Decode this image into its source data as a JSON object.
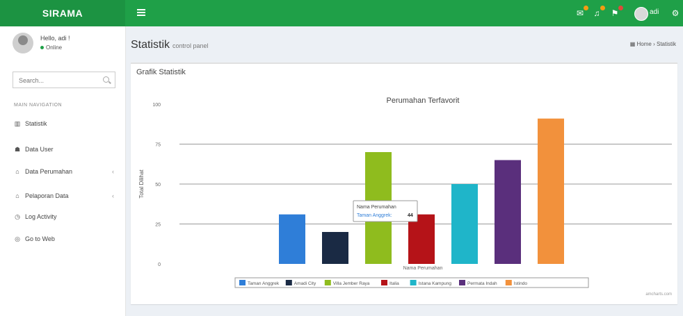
{
  "app": {
    "brand": "SIRAMA"
  },
  "topbar": {
    "user_label": "adi"
  },
  "user_panel": {
    "name": "Hello, adi !",
    "status": "Online"
  },
  "search": {
    "placeholder": "Search..."
  },
  "nav": {
    "header": "MAIN NAVIGATION",
    "items": [
      {
        "label": "Statistik",
        "icon": "chart-icon"
      },
      {
        "label": "Data User",
        "icon": "users-icon"
      },
      {
        "label": "Data Perumahan",
        "icon": "home-icon",
        "has_children": true
      },
      {
        "label": "Pelaporan Data",
        "icon": "home-icon",
        "has_children": true
      },
      {
        "label": "Log Activity",
        "icon": "clock-icon"
      },
      {
        "label": "Go to Web",
        "icon": "globe-icon"
      }
    ]
  },
  "page": {
    "title": "Statistik",
    "subtitle": "control panel",
    "breadcrumb": [
      "Home",
      "Statistik"
    ]
  },
  "box": {
    "title": "Grafik Statistik"
  },
  "tooltip": {
    "title": "Nama Perumahan",
    "series": "Taman Anggrek",
    "value": "44"
  },
  "credit": "amcharts.com",
  "chart_data": {
    "type": "bar",
    "title": "Perumahan Terfavorit",
    "xlabel": "Nama Perumahan",
    "ylabel": "Total Dilihat",
    "ylim": [
      0,
      100
    ],
    "ticks": [
      0,
      25,
      50,
      75,
      100
    ],
    "grid": true,
    "legend_position": "bottom",
    "series": [
      {
        "name": "Taman Anggrek",
        "value": 31,
        "color": "#2f7ed8"
      },
      {
        "name": "Amadi City",
        "value": 20,
        "color": "#1a2a44"
      },
      {
        "name": "Villa Jember Raya",
        "value": 70,
        "color": "#8fbc1e"
      },
      {
        "name": "Italia",
        "value": 31,
        "color": "#b51318"
      },
      {
        "name": "Istana Kampung",
        "value": 50,
        "color": "#1fb5c9"
      },
      {
        "name": "Permata Indah",
        "value": 65,
        "color": "#5a2f7c"
      },
      {
        "name": "Istindo",
        "value": 91,
        "color": "#f2913c"
      }
    ]
  },
  "colors": {
    "primary": "#1fa048",
    "brand_dark": "#1c9342"
  }
}
